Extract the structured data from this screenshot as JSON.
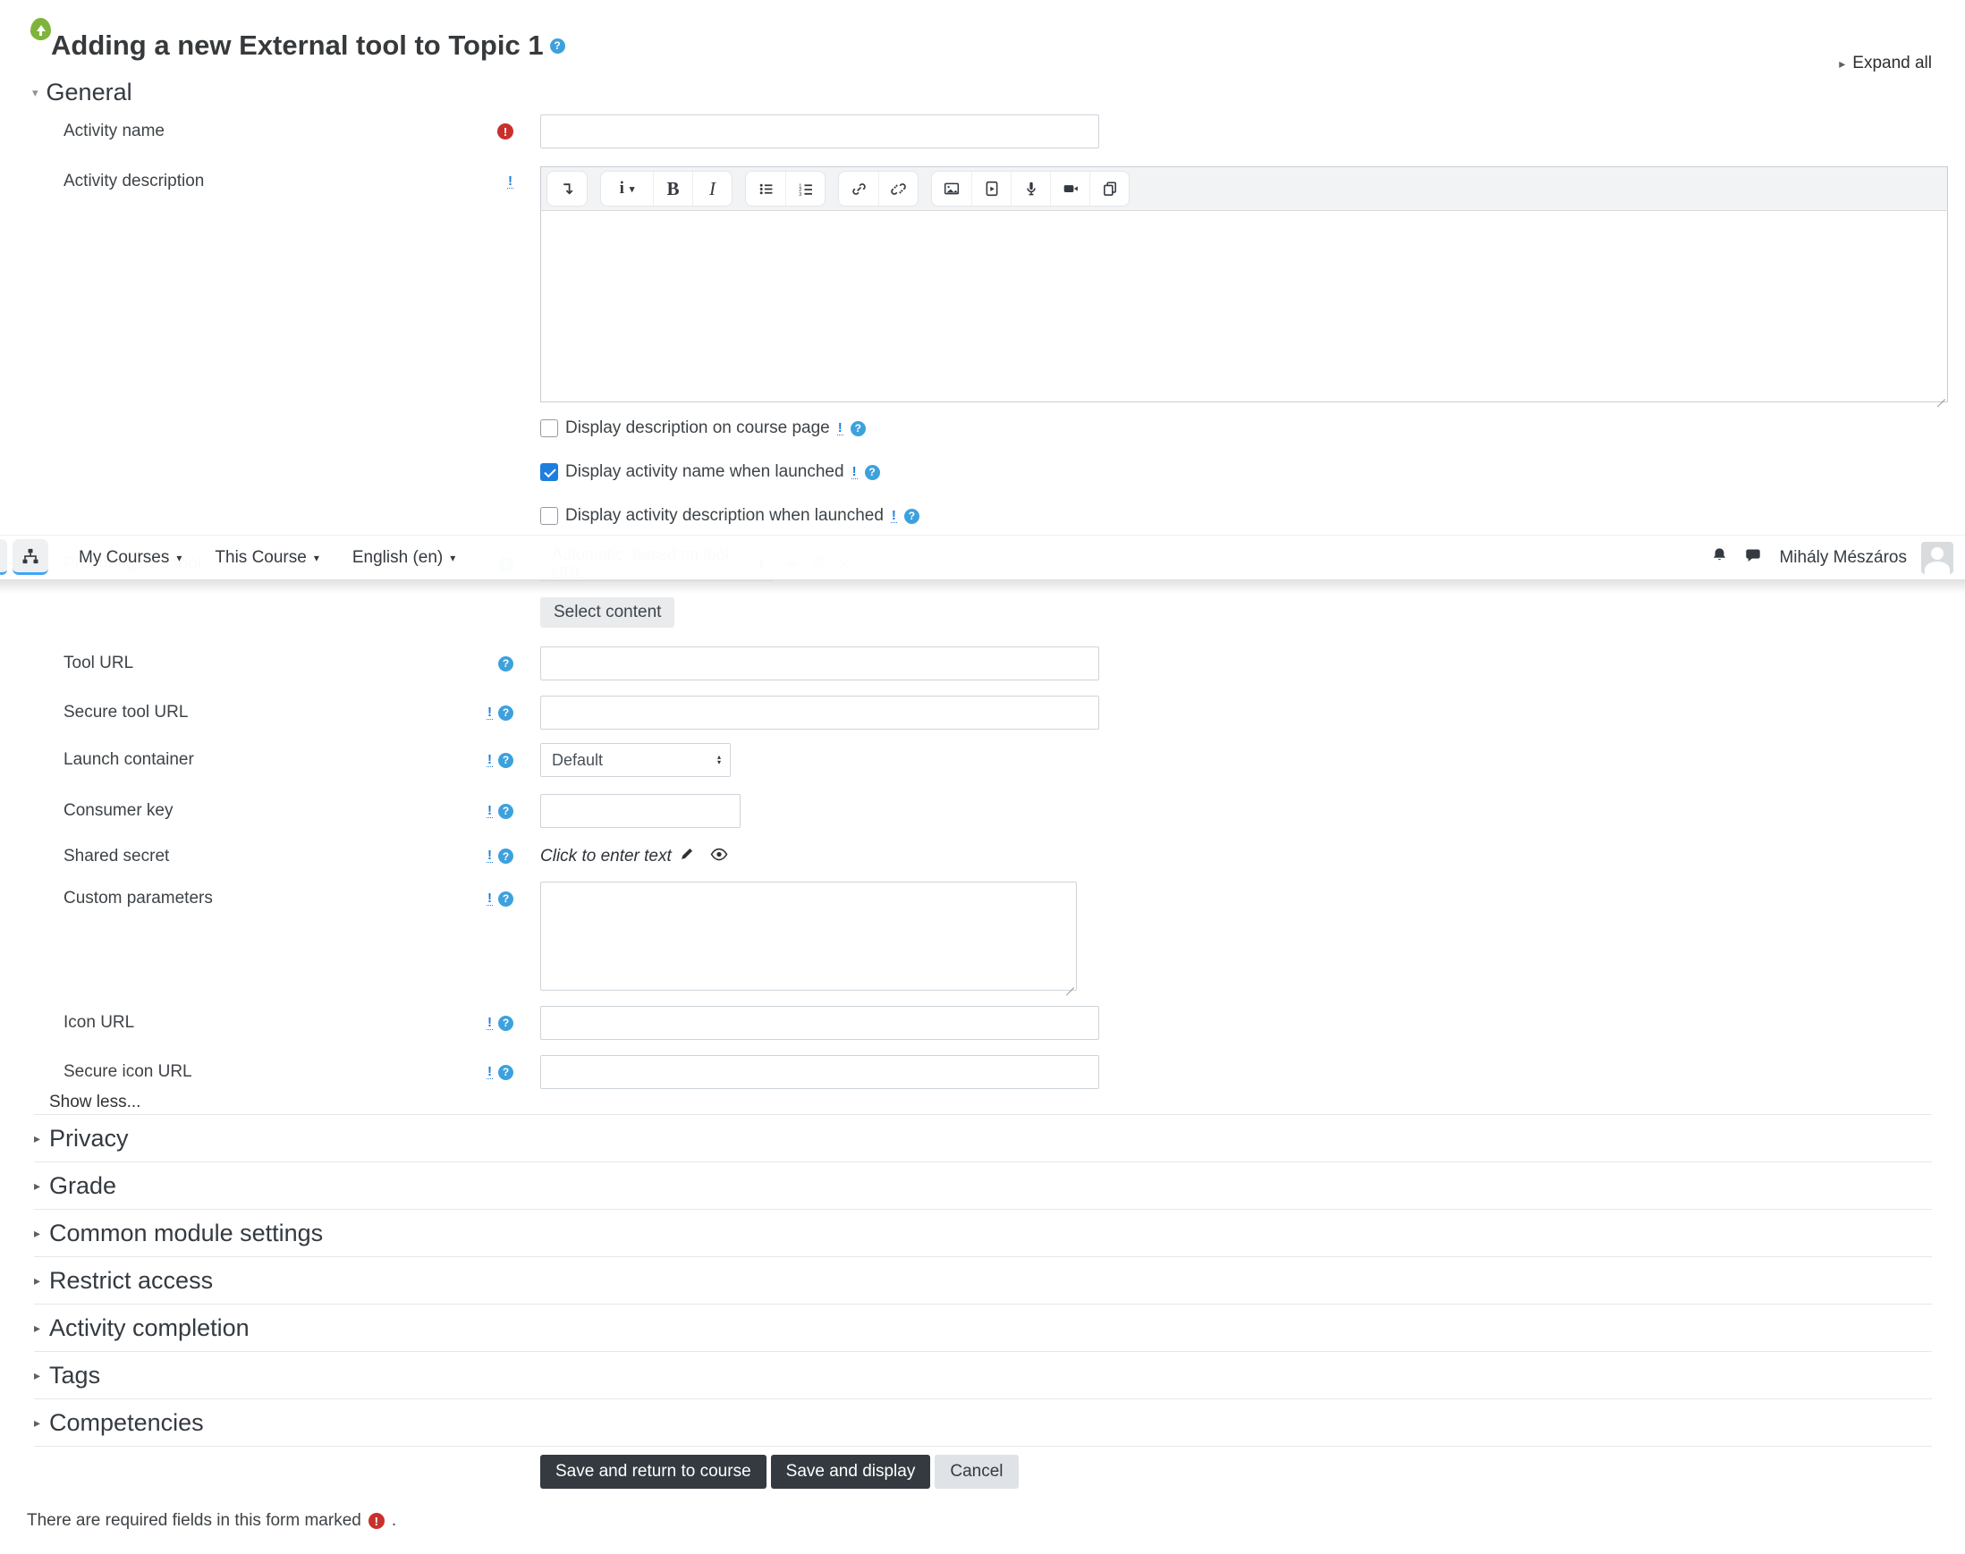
{
  "page": {
    "title": "Adding a new External tool to Topic 1",
    "expand_all_label": "Expand all",
    "required_note": "There are required fields in this form marked",
    "required_note_period": "."
  },
  "navbar": {
    "menus": [
      {
        "label": "My Courses"
      },
      {
        "label": "This Course"
      },
      {
        "label": "English (en)"
      }
    ],
    "user_name": "Mihály Mészáros"
  },
  "form": {
    "general_heading": "General",
    "activity_name_label": "Activity name",
    "activity_description_label": "Activity description",
    "checkboxes": [
      {
        "label": "Display description on course page",
        "checked": false
      },
      {
        "label": "Display activity name when launched",
        "checked": true
      },
      {
        "label": "Display activity description when launched",
        "checked": false
      }
    ],
    "preconfigured_tool": {
      "label": "Preconfigured tool",
      "selected_option": "Automatic, based on tool URL"
    },
    "select_content_button": "Select content",
    "tool_url_label": "Tool URL",
    "secure_tool_url_label": "Secure tool URL",
    "launch_container": {
      "label": "Launch container",
      "selected_option": "Default"
    },
    "consumer_key_label": "Consumer key",
    "shared_secret": {
      "label": "Shared secret",
      "value": "Click to enter text"
    },
    "custom_parameters_label": "Custom parameters",
    "icon_url_label": "Icon URL",
    "secure_icon_url_label": "Secure icon URL",
    "show_less_label": "Show less..."
  },
  "sections": [
    {
      "label": "Privacy"
    },
    {
      "label": "Grade"
    },
    {
      "label": "Common module settings"
    },
    {
      "label": "Restrict access"
    },
    {
      "label": "Activity completion"
    },
    {
      "label": "Tags"
    },
    {
      "label": "Competencies"
    }
  ],
  "actions": {
    "save_return": "Save and return to course",
    "save_display": "Save and display",
    "cancel": "Cancel"
  },
  "editor": {
    "toolbar_icons": [
      "collapse-toolbar-icon",
      "paragraph-styles-icon",
      "bold-icon",
      "italic-icon",
      "unordered-list-icon",
      "ordered-list-icon",
      "link-icon",
      "unlink-icon",
      "image-icon",
      "media-icon",
      "record-audio-icon",
      "record-video-icon",
      "manage-files-icon"
    ]
  },
  "icons": {
    "activity_type": "external-tool-icon",
    "help": "help-icon",
    "required": "required-icon",
    "advanced": "advanced-icon",
    "section_collapsed": "chevron-right-icon",
    "section_expanded": "chevron-down-icon",
    "navbar_left": "sitemap-icon",
    "notifications": "bell-icon",
    "messages": "chat-icon",
    "shared_secret_edit": "pencil-icon",
    "shared_secret_reveal": "eye-icon",
    "preconfigured_add": "plus-icon",
    "preconfigured_edit": "gear-icon",
    "preconfigured_delete": "close-icon"
  },
  "colors": {
    "accent_blue": "#1d7ede",
    "help_icon_blue": "#3da1dd",
    "required_red": "#c9302c",
    "tool_icon_green": "#7fb43c",
    "nav_active_underline": "#42a5f5",
    "dark_button": "#343a40"
  }
}
